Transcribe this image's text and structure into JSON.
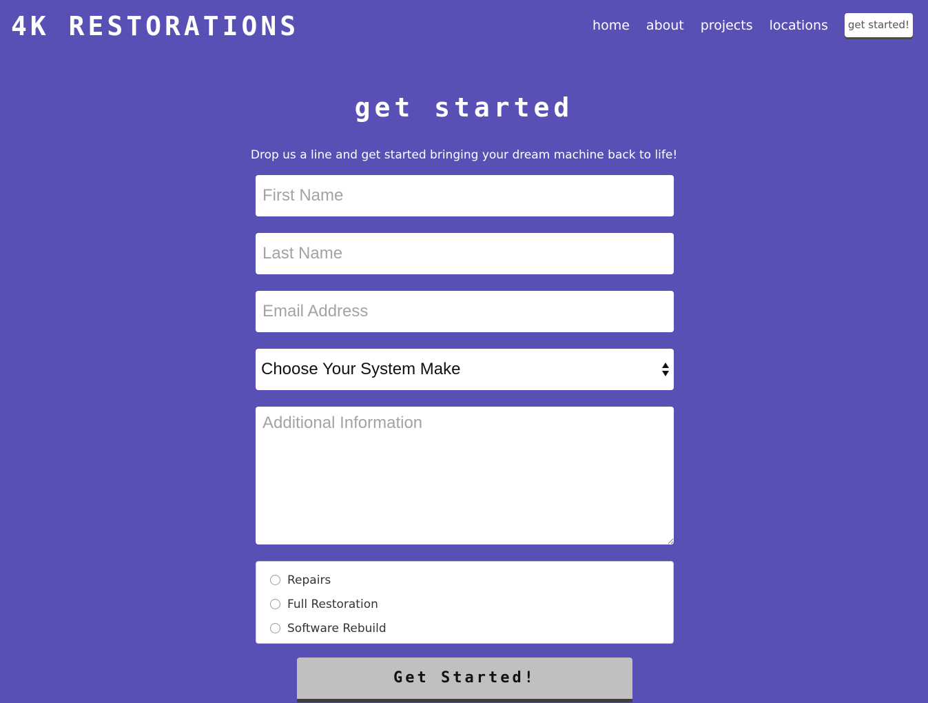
{
  "header": {
    "logo": "4K RESTORATIONS",
    "nav": {
      "home": "home",
      "about": "about",
      "projects": "projects",
      "locations": "locations",
      "cta": "get started!"
    }
  },
  "main": {
    "title": "get started",
    "intro": "Drop us a line and get started bringing your dream machine back to life!",
    "form": {
      "first_name_placeholder": "First Name",
      "last_name_placeholder": "Last Name",
      "email_placeholder": "Email Address",
      "system_make_selected": "Choose Your System Make",
      "additional_info_placeholder": "Additional Information",
      "service_options": {
        "repairs": "Repairs",
        "full_restoration": "Full Restoration",
        "software_rebuild": "Software Rebuild"
      },
      "submit_label": "Get Started!"
    }
  },
  "icons": {
    "select_arrows": "up-down-arrows-icon",
    "radio": "radio-circle-icon"
  },
  "colors": {
    "background": "#5850b5",
    "field_background": "#ffffff",
    "placeholder": "#a3a3a3",
    "submit_button": "#c0c0c0"
  }
}
